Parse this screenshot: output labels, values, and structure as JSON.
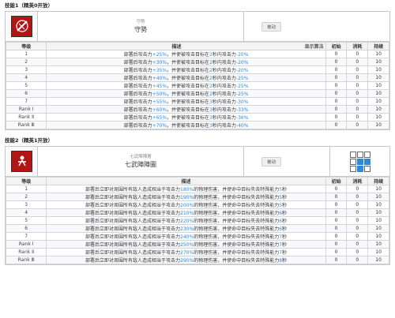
{
  "skill1": {
    "title": "技能1（精英0开放）",
    "name_sub": "守势",
    "name": "守勢",
    "type_badge": "被动",
    "headers": {
      "level": "等级",
      "desc": "描述",
      "show": "显示算法",
      "sp_init": "初始",
      "sp_cost": "消耗",
      "duration": "持续"
    },
    "desc_prefix": "部署后攻击力",
    "desc_mid": "，并使被攻击目标在",
    "desc_mid2": "秒内攻击力",
    "rows": [
      {
        "level": "1",
        "atk": "+25%",
        "secs": "2",
        "reduce": "-20%",
        "init": "0",
        "cost": "0",
        "dur": "10"
      },
      {
        "level": "2",
        "atk": "+30%",
        "secs": "2",
        "reduce": "-20%",
        "init": "0",
        "cost": "0",
        "dur": "10"
      },
      {
        "level": "3",
        "atk": "+35%",
        "secs": "2",
        "reduce": "-20%",
        "init": "0",
        "cost": "0",
        "dur": "10"
      },
      {
        "level": "4",
        "atk": "+40%",
        "secs": "2",
        "reduce": "-25%",
        "init": "0",
        "cost": "0",
        "dur": "10"
      },
      {
        "level": "5",
        "atk": "+45%",
        "secs": "2",
        "reduce": "-25%",
        "init": "0",
        "cost": "0",
        "dur": "10"
      },
      {
        "level": "6",
        "atk": "+50%",
        "secs": "2",
        "reduce": "-25%",
        "init": "0",
        "cost": "0",
        "dur": "10"
      },
      {
        "level": "7",
        "atk": "+55%",
        "secs": "3",
        "reduce": "-30%",
        "init": "0",
        "cost": "0",
        "dur": "10"
      },
      {
        "level": "Rank Ⅰ",
        "atk": "+60%",
        "secs": "3",
        "reduce": "-33%",
        "init": "0",
        "cost": "0",
        "dur": "10"
      },
      {
        "level": "Rank Ⅱ",
        "atk": "+65%",
        "secs": "3",
        "reduce": "-36%",
        "init": "0",
        "cost": "0",
        "dur": "10"
      },
      {
        "level": "Rank Ⅲ",
        "atk": "+70%",
        "secs": "3",
        "reduce": "-40%",
        "init": "0",
        "cost": "0",
        "dur": "10"
      }
    ]
  },
  "skill2": {
    "title": "技能2（精英1开放）",
    "name_sub": "七武陣陣層",
    "name": "七武陣陣圖",
    "type_badge": "被动",
    "headers": {
      "level": "等级",
      "desc": "描述",
      "sp_init": "初始",
      "sp_cost": "消耗",
      "duration": "持续"
    },
    "desc_prefix": "部署后立即对周围所有敌人造成相当于攻击力",
    "desc_mid": "的物理伤害，并使命中目标失去特殊能力",
    "desc_suffix": "秒",
    "range": [
      false,
      false,
      false,
      false,
      true,
      true,
      false,
      true,
      false
    ],
    "rows": [
      {
        "level": "1",
        "pct": "180%",
        "secs": "5",
        "init": "0",
        "cost": "0",
        "dur": "10"
      },
      {
        "level": "2",
        "pct": "190%",
        "secs": "5",
        "init": "0",
        "cost": "0",
        "dur": "10"
      },
      {
        "level": "3",
        "pct": "200%",
        "secs": "5",
        "init": "0",
        "cost": "0",
        "dur": "10"
      },
      {
        "level": "4",
        "pct": "210%",
        "secs": "6",
        "init": "0",
        "cost": "0",
        "dur": "10"
      },
      {
        "level": "5",
        "pct": "220%",
        "secs": "6",
        "init": "0",
        "cost": "0",
        "dur": "10"
      },
      {
        "level": "6",
        "pct": "230%",
        "secs": "6",
        "init": "0",
        "cost": "0",
        "dur": "10"
      },
      {
        "level": "7",
        "pct": "240%",
        "secs": "7",
        "init": "0",
        "cost": "0",
        "dur": "10"
      },
      {
        "level": "Rank Ⅰ",
        "pct": "250%",
        "secs": "7",
        "init": "0",
        "cost": "0",
        "dur": "10"
      },
      {
        "level": "Rank Ⅱ",
        "pct": "270%",
        "secs": "7",
        "init": "0",
        "cost": "0",
        "dur": "10"
      },
      {
        "level": "Rank Ⅲ",
        "pct": "290%",
        "secs": "8",
        "init": "0",
        "cost": "0",
        "dur": "10"
      }
    ]
  },
  "icons": {
    "skill1": "sword-slash-icon",
    "skill2": "warrior-charge-icon"
  },
  "colors": {
    "highlight": "#2a8ee6",
    "icon_bg": "#b31515",
    "range_on": "#2e8ad8"
  }
}
